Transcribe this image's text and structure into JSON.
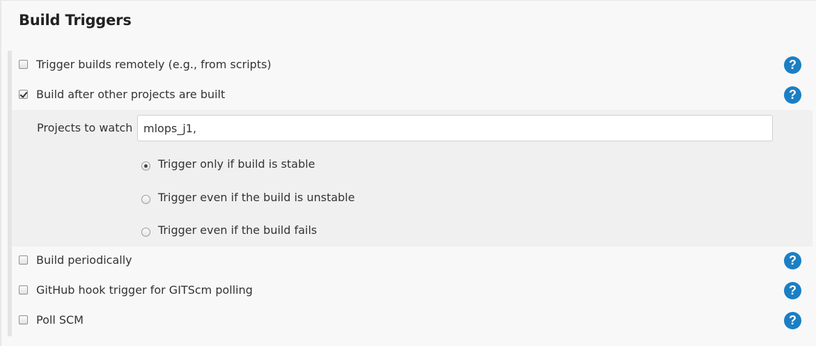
{
  "section": {
    "title": "Build Triggers"
  },
  "triggers": [
    {
      "label": "Trigger builds remotely (e.g., from scripts)",
      "checked": false
    },
    {
      "label": "Build after other projects are built",
      "checked": true
    },
    {
      "label": "Build periodically",
      "checked": false
    },
    {
      "label": "GitHub hook trigger for GITScm polling",
      "checked": false
    },
    {
      "label": "Poll SCM",
      "checked": false
    }
  ],
  "build_after": {
    "projects_label": "Projects to watch",
    "projects_value": "mlops_j1,",
    "options": [
      {
        "label": "Trigger only if build is stable",
        "selected": true
      },
      {
        "label": "Trigger even if the build is unstable",
        "selected": false
      },
      {
        "label": "Trigger even if the build fails",
        "selected": false
      }
    ]
  },
  "help_icon_glyph": "?",
  "colors": {
    "help_icon": "#1b7fc4",
    "background": "#f8f8f8",
    "sub_panel": "#f0f0f0"
  }
}
